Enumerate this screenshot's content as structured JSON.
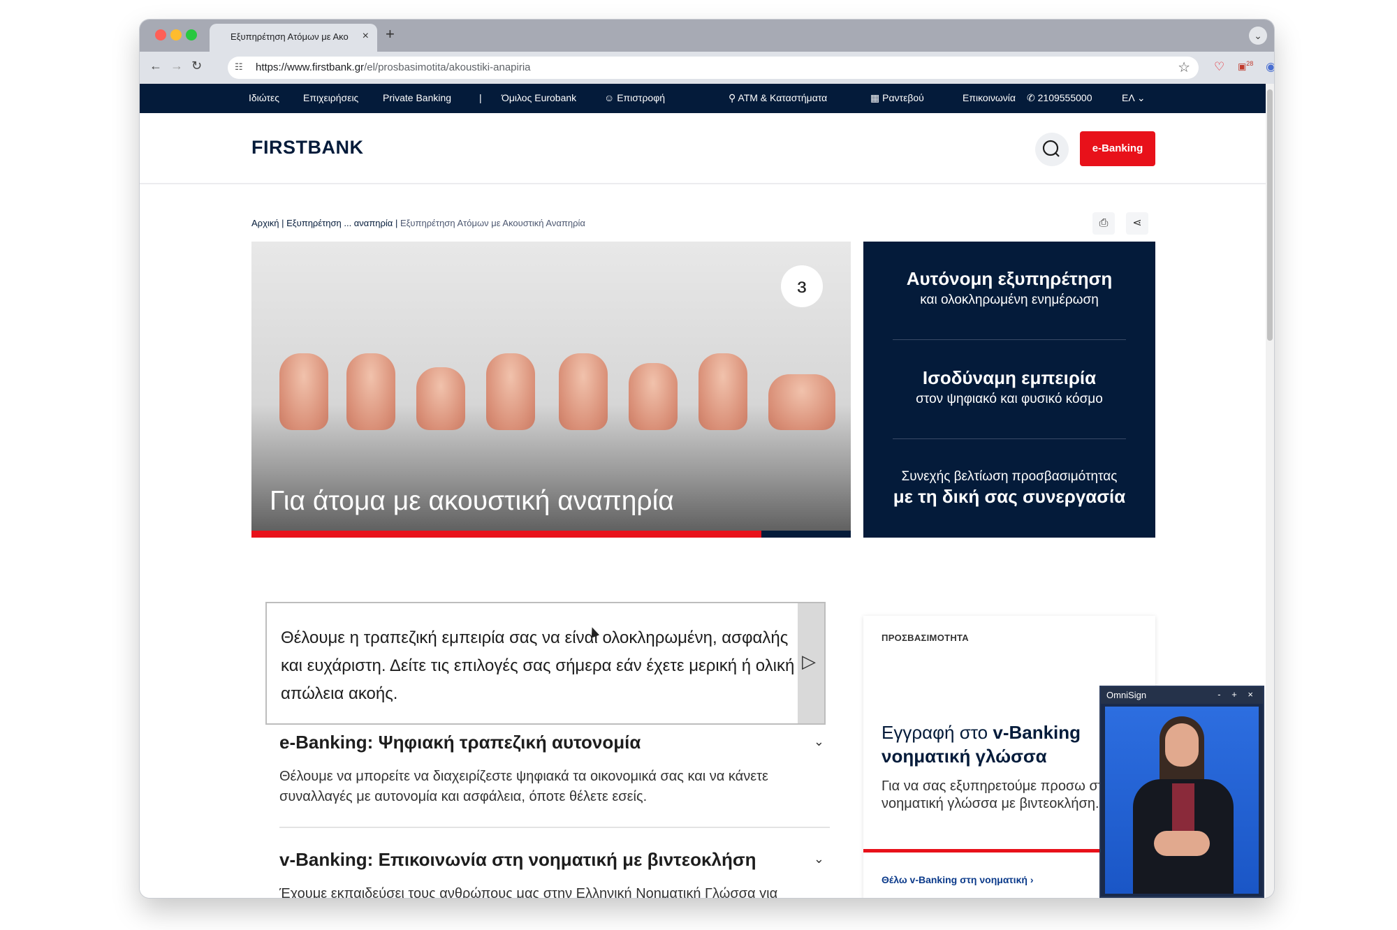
{
  "browser": {
    "tab_title": "Εξυπηρέτηση Ατόμων με Ακο",
    "url_domain": "https://www.firstbank.gr",
    "url_path": "/el/prosbasimotita/akoustiki-anapiria",
    "extension_badge": "28"
  },
  "topnav": {
    "items": [
      "Ιδιώτες",
      "Επιχειρήσεις",
      "Private Banking",
      "|",
      "Όμιλος Eurobank",
      "Επιστροφή",
      "ATM & Καταστήματα",
      "Ραντεβού",
      "Επικοινωνία",
      "2109555000",
      "ΕΛ"
    ]
  },
  "header": {
    "logo": "FIRSTBANK",
    "ebanking_label": "e-Banking"
  },
  "breadcrumb": {
    "home": "Αρχική",
    "parent": "Εξυπηρέτηση ... αναπηρία",
    "current": "Εξυπηρέτηση Ατόμων με Ακουστική Αναπηρία"
  },
  "hero": {
    "title": "Για άτομα με ακουστική αναπηρία"
  },
  "promo": {
    "block1_strong": "Αυτόνομη εξυπηρέτηση",
    "block1_light": "και ολοκληρωμένη ενημέρωση",
    "block2_strong": "Ισοδύναμη εμπειρία",
    "block2_light": "στον ψηφιακό και φυσικό κόσμο",
    "block3_light": "Συνεχής βελτίωση προσβασιμότητας",
    "block3_strong": "με τη δική σας συνεργασία"
  },
  "intro": {
    "text": "Θέλουμε η τραπεζική εμπειρία σας να είναι ολοκληρωμένη, ασφαλής και ευχάριστη. Δείτε τις επιλογές σας σήμερα εάν έχετε μερική ή ολική απώλεια ακοής."
  },
  "accordion": [
    {
      "title": "e-Banking: Ψηφιακή τραπεζική αυτονομία",
      "body": "Θέλουμε να μπορείτε να διαχειρίζεστε ψηφιακά τα οικονομικά σας και να κάνετε συναλλαγές με αυτονομία και ασφάλεια, όποτε θέλετε εσείς."
    },
    {
      "title": "v-Banking: Επικοινωνία στη νοηματική με βιντεοκλήση",
      "body": "Έχουμε εκπαιδεύσει τους ανθρώπους μας στην Ελληνική Νοηματική Γλώσσα για να σας καθοδηγούν διαδικτυακά με βιντεοκλήση."
    }
  ],
  "side_card": {
    "kicker": "ΠΡΟΣΒΑΣΙΜΟΤΗΤΑ",
    "title_prefix": "Εγγραφή στο",
    "title_bold1": "v-Banking",
    "title_bold2": "νοηματική γλώσσα",
    "body": "Για να σας εξυπηρετούμε προσω στη νοηματική γλώσσα με βιντεοκλήση.",
    "link": "Θέλω v-Banking στη νοηματική"
  },
  "omnisign": {
    "title": "OmniSign",
    "controls": "- + ×"
  }
}
